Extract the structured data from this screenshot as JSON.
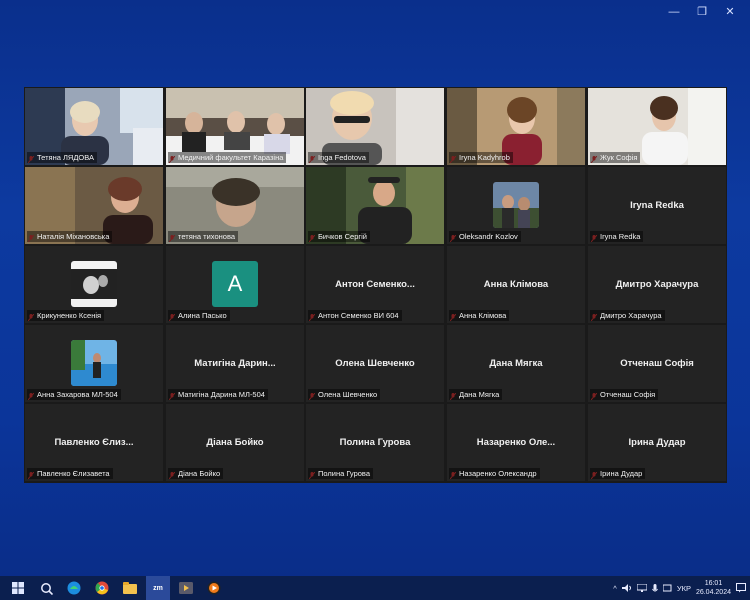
{
  "window": {
    "minimize": "—",
    "restore": "❐",
    "close": "✕"
  },
  "tiles": [
    {
      "label": "Тетяна ЛЯДОВА"
    },
    {
      "label": "Медичний факультет Каразіна"
    },
    {
      "label": "Inga Fedotova"
    },
    {
      "label": "Iryna Kadyhrob"
    },
    {
      "label": "Жук Софія"
    },
    {
      "label": "Наталія Міхановська"
    },
    {
      "label": "тетяна тихонова"
    },
    {
      "label": "Бичков Сергій"
    },
    {
      "label": "Oleksandr Kozlov"
    },
    {
      "label": "Iryna Redka",
      "center": "Iryna Redka"
    },
    {
      "label": "Крикуненко Ксенія"
    },
    {
      "label": "Алина Пасько",
      "avatar_letter": "A"
    },
    {
      "label": "Антон Семенко ВИ 604",
      "center": "Антон  Семенко..."
    },
    {
      "label": "Анна Клімова",
      "center": "Анна Клімова"
    },
    {
      "label": "Дмитро Харачура",
      "center": "Дмитро Харачура"
    },
    {
      "label": "Анна Захарова МЛ-504"
    },
    {
      "label": "Матигіна Дарина МЛ-504",
      "center": "Матигіна  Дарин..."
    },
    {
      "label": "Олена Шевченко",
      "center": "Олена Шевченко"
    },
    {
      "label": "Дана Мягка",
      "center": "Дана Мягка"
    },
    {
      "label": "Отченаш Софія",
      "center": "Отченаш Софія"
    },
    {
      "label": "Павленко Єлизавета",
      "center": "Павленко Єлиз..."
    },
    {
      "label": "Діана Бойко",
      "center": "Діана Бойко"
    },
    {
      "label": "Полина Гурова",
      "center": "Полина Гурова"
    },
    {
      "label": "Назаренко Олександр",
      "center": "Назаренко  Оле..."
    },
    {
      "label": "Ірина Дудар",
      "center": "Ірина Дудар"
    }
  ],
  "taskbar": {
    "icons": [
      "windows-start-icon",
      "search-icon",
      "edge-icon",
      "chrome-icon",
      "file-explorer-icon",
      "zoom-icon",
      "media-player-icon",
      "media-icon"
    ],
    "zoom_label": "zm",
    "language": "УКР",
    "time": "16:01",
    "date": "26.04.2024"
  },
  "colors": {
    "accent_active": "#3fcf8e",
    "avatar_teal": "#1a9080",
    "muted_red": "#e03a3a"
  }
}
